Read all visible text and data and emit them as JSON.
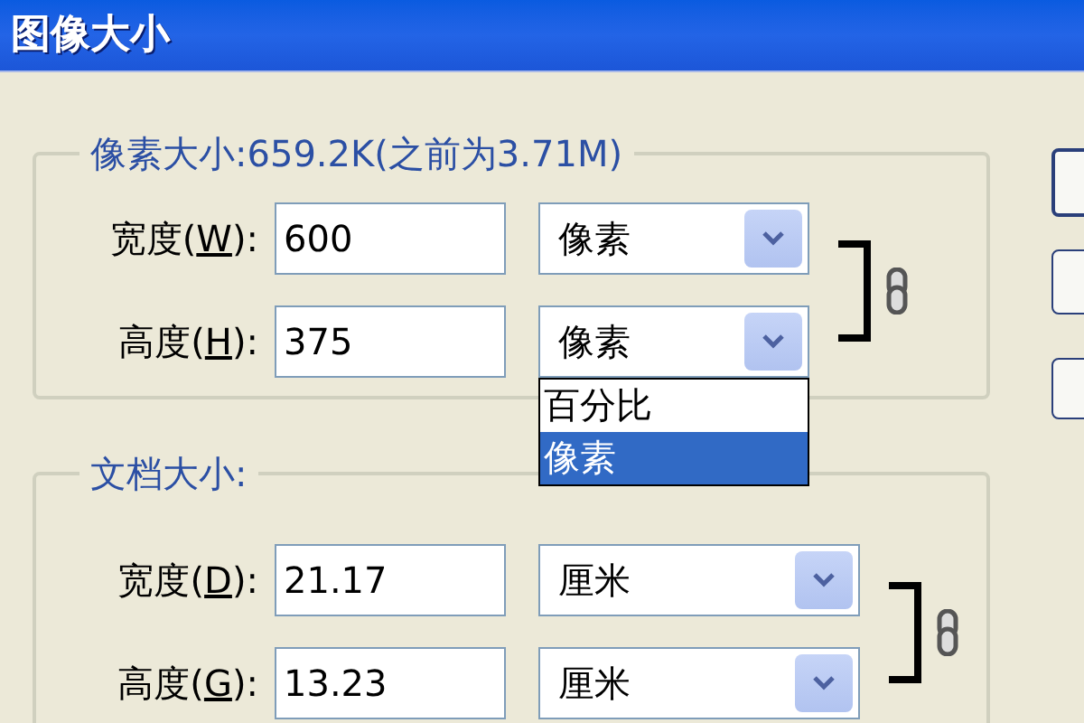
{
  "window": {
    "title": "图像大小"
  },
  "pixel_dimensions": {
    "legend": "像素大小:659.2K(之前为3.71M)",
    "constrained": true,
    "fields": [
      {
        "label": "宽度(",
        "hotkey": "W",
        "label_end": "):",
        "value": "600",
        "unit": "像素"
      },
      {
        "label": "高度(",
        "hotkey": "H",
        "label_end": "):",
        "value": "375",
        "unit": "像素",
        "menu": [
          {
            "label": "百分比",
            "selected": false
          },
          {
            "label": "像素",
            "selected": true
          }
        ]
      }
    ]
  },
  "document_size": {
    "legend": "文档大小:",
    "constrained": true,
    "fields": [
      {
        "label": "宽度(",
        "hotkey": "D",
        "label_end": "):",
        "value": "21.17",
        "unit": "厘米"
      },
      {
        "label": "高度(",
        "hotkey": "G",
        "label_end": "):",
        "value": "13.23",
        "unit": "厘米"
      }
    ]
  }
}
